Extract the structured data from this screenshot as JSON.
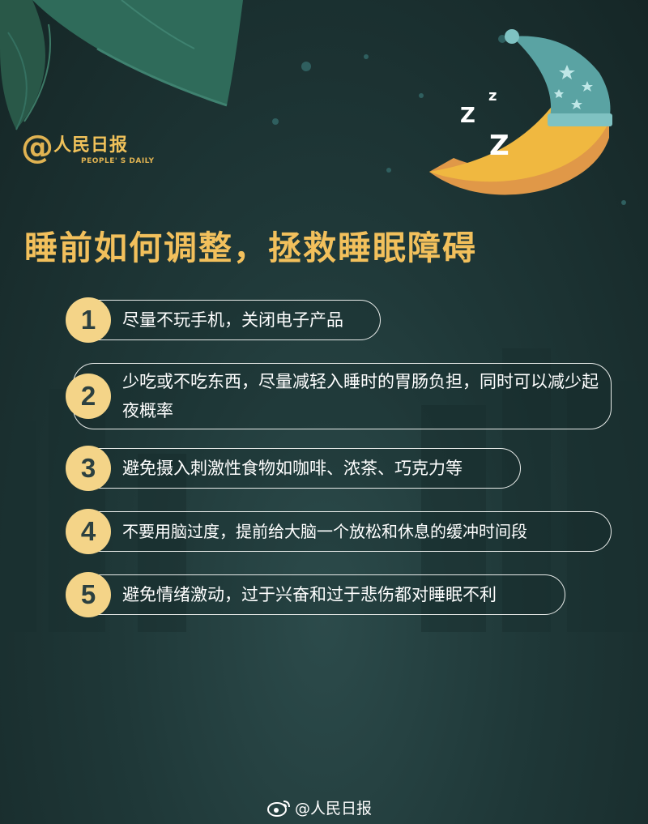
{
  "header": {
    "logo_at": "@",
    "logo_name": "人民日报",
    "logo_sub": "PEOPLE' S DAILY",
    "zzz": [
      "Z",
      "z",
      "Z"
    ]
  },
  "title": "睡前如何调整，拯救睡眠障碍",
  "tips": [
    {
      "num": "1",
      "text": "尽量不玩手机，关闭电子产品"
    },
    {
      "num": "2",
      "text": "少吃或不吃东西，尽量减轻入睡时的胃肠负担，同时可以减少起夜概率"
    },
    {
      "num": "3",
      "text": "避免摄入刺激性食物如咖啡、浓茶、巧克力等"
    },
    {
      "num": "4",
      "text": "不要用脑过度，提前给大脑一个放松和休息的缓冲时间段"
    },
    {
      "num": "5",
      "text": "避免情绪激动，过于兴奋和过于悲伤都对睡眠不利"
    }
  ],
  "footer": {
    "handle": "@人民日报"
  },
  "colors": {
    "background": "#1f3838",
    "title": "#f2c05c",
    "badge": "#f4d488",
    "moon": "#f0b840",
    "nightcap": "#5aa3a3",
    "leaf": "#2f6b5a"
  },
  "icons": [
    "leaf-decoration",
    "moon-icon",
    "nightcap-icon",
    "star-icon",
    "weibo-icon"
  ]
}
